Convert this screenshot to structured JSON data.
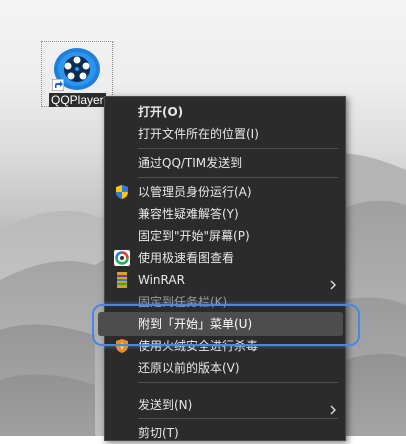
{
  "desktop": {
    "icon_label": "QQPlayer"
  },
  "menu": {
    "items": [
      {
        "label": "打开(O)",
        "icon": ""
      },
      {
        "label": "打开文件所在的位置(I)",
        "icon": ""
      },
      {
        "label": "通过QQ/TIM发送到",
        "icon": ""
      },
      {
        "label": "以管理员身份运行(A)",
        "icon": "shield-icon"
      },
      {
        "label": "兼容性疑难解答(Y)",
        "icon": ""
      },
      {
        "label": "固定到\"开始\"屏幕(P)",
        "icon": ""
      },
      {
        "label": "使用极速看图查看",
        "icon": "image-viewer-icon"
      },
      {
        "label": "WinRAR",
        "icon": "winrar-icon",
        "submenu": true
      },
      {
        "label": "固定到任务栏(K)",
        "icon": ""
      },
      {
        "label": "附到「开始」菜单(U)",
        "icon": ""
      },
      {
        "label": "使用火绒安全进行杀毒",
        "icon": "huorong-icon"
      },
      {
        "label": "还原以前的版本(V)",
        "icon": ""
      },
      {
        "label": "发送到(N)",
        "icon": "",
        "submenu": true
      },
      {
        "label": "剪切(T)",
        "icon": ""
      }
    ]
  },
  "colors": {
    "menu_bg": "#2b2b2b",
    "highlight_border": "#4f86d6",
    "highlight_bg": "#4d4d4d"
  }
}
